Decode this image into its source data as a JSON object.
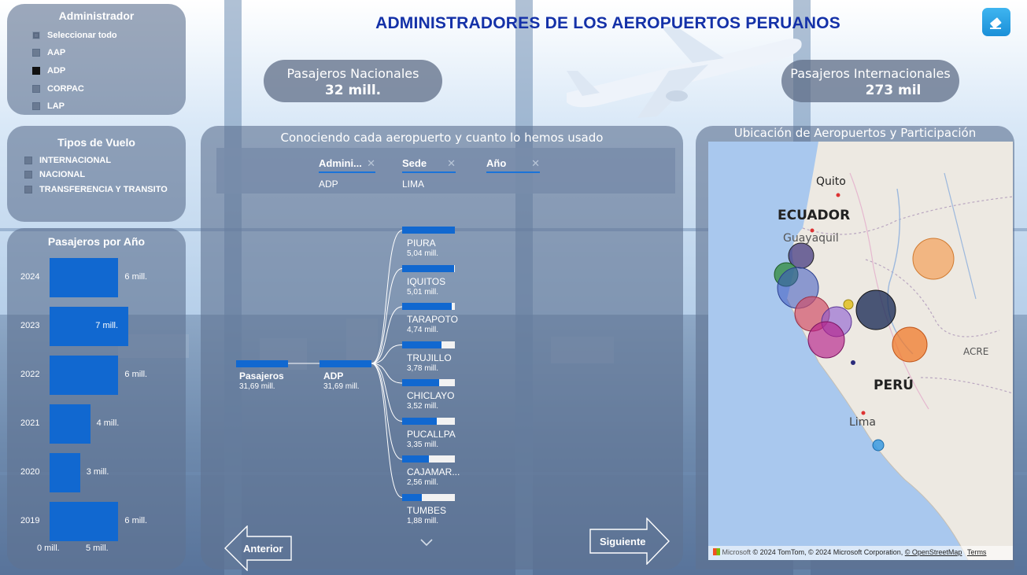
{
  "title": "ADMINISTRADORES DE LOS AEROPUERTOS PERUANOS",
  "icons": {
    "eraser": "eraser-icon",
    "collapse": "chevron-down-icon"
  },
  "slicer_admin": {
    "title": "Administrador",
    "items": [
      {
        "label": "Seleccionar todo",
        "state": "partial"
      },
      {
        "label": "AAP",
        "state": "off"
      },
      {
        "label": "ADP",
        "state": "on"
      },
      {
        "label": "CORPAC",
        "state": "off"
      },
      {
        "label": "LAP",
        "state": "off"
      }
    ]
  },
  "slicer_tipo": {
    "title": "Tipos de Vuelo",
    "items": [
      {
        "label": "INTERNACIONAL",
        "state": "off"
      },
      {
        "label": "NACIONAL",
        "state": "off"
      },
      {
        "label": "TRANSFERENCIA Y TRANSITO",
        "state": "off"
      }
    ]
  },
  "kpi_nacional": {
    "label": "Pasajeros Nacionales",
    "value": "32 mill."
  },
  "kpi_internacional": {
    "label": "Pasajeros Internacionales",
    "value": "273 mil"
  },
  "chart_data": {
    "type": "bar",
    "orientation": "horizontal",
    "title": "Pasajeros por Año",
    "categories": [
      "2024",
      "2023",
      "2022",
      "2021",
      "2020",
      "2019"
    ],
    "values": [
      6,
      7,
      6,
      4,
      3,
      6
    ],
    "data_labels": [
      "6 mill.",
      "7 mill.",
      "6 mill.",
      "4 mill.",
      "3 mill.",
      "6 mill."
    ],
    "x_ticks": [
      "0 mill.",
      "5 mill."
    ],
    "xlim": [
      0,
      7.5
    ],
    "color": "#1168d0"
  },
  "tree": {
    "title": "Conociendo cada aeropuerto y cuanto lo hemos usado",
    "breadcrumbs": [
      {
        "label": "Admini...",
        "value": "ADP"
      },
      {
        "label": "Sede",
        "value": "LIMA"
      },
      {
        "label": "Año",
        "value": ""
      }
    ],
    "root": {
      "label": "Pasajeros",
      "value": "31,69 mill."
    },
    "level1": {
      "label": "ADP",
      "value": "31,69 mill."
    },
    "children": [
      {
        "label": "PIURA",
        "value": "5,04 mill.",
        "share": 1.0
      },
      {
        "label": "IQUITOS",
        "value": "5,01 mill.",
        "share": 0.99
      },
      {
        "label": "TARAPOTO",
        "value": "4,74 mill.",
        "share": 0.94
      },
      {
        "label": "TRUJILLO",
        "value": "3,78 mill.",
        "share": 0.75
      },
      {
        "label": "CHICLAYO",
        "value": "3,52 mill.",
        "share": 0.7
      },
      {
        "label": "PUCALLPA",
        "value": "3,35 mill.",
        "share": 0.66
      },
      {
        "label": "CAJAMAR...",
        "value": "2,56 mill.",
        "share": 0.51
      },
      {
        "label": "TUMBES",
        "value": "1,88 mill.",
        "share": 0.37
      }
    ]
  },
  "nav": {
    "prev": "Anterior",
    "next": "Siguiente"
  },
  "map": {
    "title": "Ubicación de Aeropuertos y Participación",
    "labels": {
      "quito": "Quito",
      "ecuador": "ECUADOR",
      "guayaquil": "Guayaquil",
      "peru": "PERÚ",
      "lima": "Lima",
      "acre": "ACRE"
    },
    "microsoft": "Microsoft",
    "attribution": "© 2024 TomTom, © 2024 Microsoft Corporation,",
    "osm": "© OpenStreetMap",
    "terms": "Terms"
  }
}
